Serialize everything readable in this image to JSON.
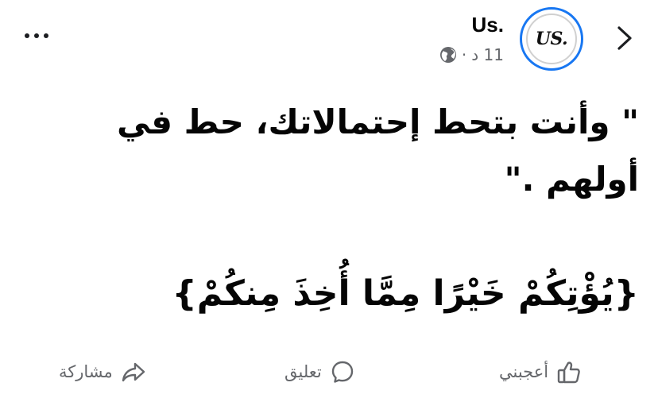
{
  "post": {
    "author": "Us.",
    "avatar_text": "US.",
    "timestamp": "11 د",
    "separator": "·",
    "privacy_icon": "globe-icon",
    "text": "\" وأنت بتحط إحتمالاتك، حط في\nأولهم .\"",
    "verse": "{يُؤْتِكُمْ خَيْرًا مِمَّا أُخِذَ مِنكُمْ}"
  },
  "header": {
    "more_icon": "more-horizontal-icon",
    "back_icon": "chevron-right-icon"
  },
  "actions": {
    "like": "أعجبني",
    "comment": "تعليق",
    "share": "مشاركة"
  },
  "colors": {
    "accent": "#1877f2",
    "secondary_text": "#65676b",
    "primary_text": "#050505"
  }
}
